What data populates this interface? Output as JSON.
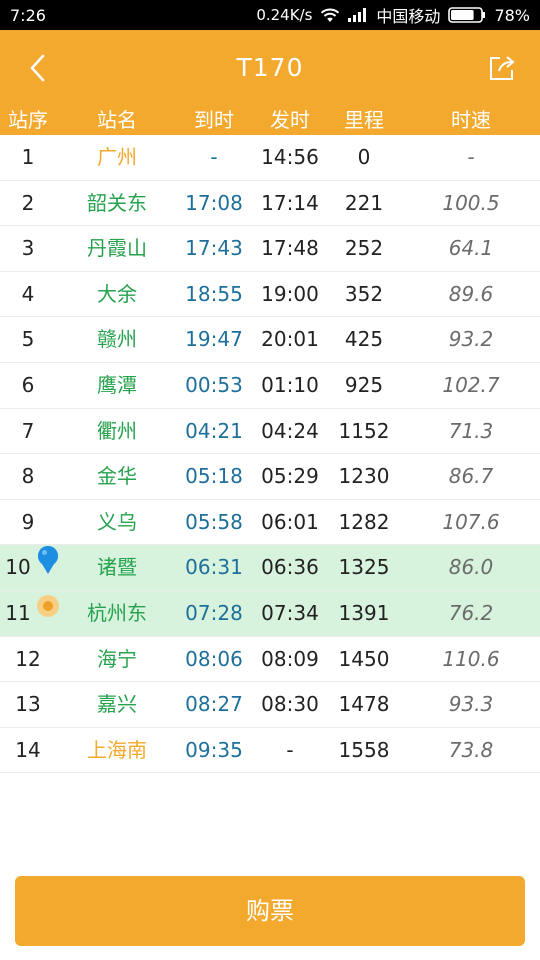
{
  "status_bar": {
    "time": "7:26",
    "speed": "0.24K/s",
    "carrier": "中国移动",
    "battery": "78%",
    "battery_level": 0.78
  },
  "header": {
    "title": "T170",
    "back_icon": "chevron-left-icon",
    "share_icon": "share-icon",
    "columns": [
      "站序",
      "站名",
      "到时",
      "发时",
      "里程",
      "时速"
    ]
  },
  "colors": {
    "accent": "#f3a92e",
    "station_name": "#27a24e",
    "terminal_name": "#f3a92e",
    "arrival_time": "#1e6f9a",
    "highlight_row": "#d7f2dd"
  },
  "stops": [
    {
      "seq": "1",
      "name": "广州",
      "arr": "-",
      "dep": "14:56",
      "km": "0",
      "speed": "-"
    },
    {
      "seq": "2",
      "name": "韶关东",
      "arr": "17:08",
      "dep": "17:14",
      "km": "221",
      "speed": "100.5"
    },
    {
      "seq": "3",
      "name": "丹霞山",
      "arr": "17:43",
      "dep": "17:48",
      "km": "252",
      "speed": "64.1"
    },
    {
      "seq": "4",
      "name": "大余",
      "arr": "18:55",
      "dep": "19:00",
      "km": "352",
      "speed": "89.6"
    },
    {
      "seq": "5",
      "name": "赣州",
      "arr": "19:47",
      "dep": "20:01",
      "km": "425",
      "speed": "93.2"
    },
    {
      "seq": "6",
      "name": "鹰潭",
      "arr": "00:53",
      "dep": "01:10",
      "km": "925",
      "speed": "102.7"
    },
    {
      "seq": "7",
      "name": "衢州",
      "arr": "04:21",
      "dep": "04:24",
      "km": "1152",
      "speed": "71.3"
    },
    {
      "seq": "8",
      "name": "金华",
      "arr": "05:18",
      "dep": "05:29",
      "km": "1230",
      "speed": "86.7"
    },
    {
      "seq": "9",
      "name": "义乌",
      "arr": "05:58",
      "dep": "06:01",
      "km": "1282",
      "speed": "107.6"
    },
    {
      "seq": "10",
      "name": "诸暨",
      "arr": "06:31",
      "dep": "06:36",
      "km": "1325",
      "speed": "86.0"
    },
    {
      "seq": "11",
      "name": "杭州东",
      "arr": "07:28",
      "dep": "07:34",
      "km": "1391",
      "speed": "76.2"
    },
    {
      "seq": "12",
      "name": "海宁",
      "arr": "08:06",
      "dep": "08:09",
      "km": "1450",
      "speed": "110.6"
    },
    {
      "seq": "13",
      "name": "嘉兴",
      "arr": "08:27",
      "dep": "08:30",
      "km": "1478",
      "speed": "93.3"
    },
    {
      "seq": "14",
      "name": "上海南",
      "arr": "09:35",
      "dep": "-",
      "km": "1558",
      "speed": "73.8"
    }
  ],
  "markers": {
    "location_pin_row": 9,
    "train_position_row": 10,
    "highlight_rows": [
      9,
      10
    ],
    "terminal_rows": [
      0,
      13
    ]
  },
  "buy_button": {
    "label": "购票"
  }
}
